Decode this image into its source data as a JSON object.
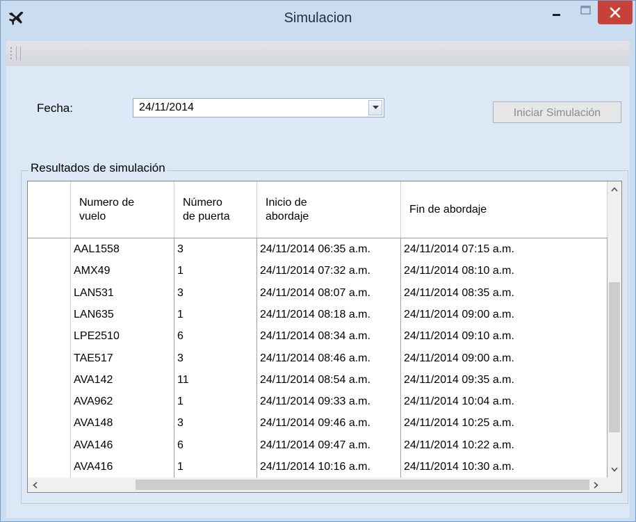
{
  "window": {
    "title": "Simulacion",
    "colors": {
      "frame": "#c9dcf0",
      "client": "#dce8f5",
      "close": "#c7413b"
    },
    "icon": "airplane-icon"
  },
  "form": {
    "fecha_label": "Fecha:",
    "fecha_value": "24/11/2014",
    "iniciar_label": "Iniciar Simulación"
  },
  "results": {
    "group_label": "Resultados de simulación",
    "columns": [
      {
        "line1": "Numero de",
        "line2": "vuelo"
      },
      {
        "line1": "Número",
        "line2": "de puerta"
      },
      {
        "line1": "Inicio de",
        "line2": "abordaje"
      },
      {
        "line1": "Fin de abordaje",
        "line2": ""
      }
    ],
    "rows": [
      [
        "AAL1558",
        "3",
        "24/11/2014 06:35 a.m.",
        "24/11/2014 07:15 a.m."
      ],
      [
        "AMX49",
        "1",
        "24/11/2014 07:32 a.m.",
        "24/11/2014 08:10 a.m."
      ],
      [
        "LAN531",
        "3",
        "24/11/2014 08:07 a.m.",
        "24/11/2014 08:35 a.m."
      ],
      [
        "LAN635",
        "1",
        "24/11/2014 08:18 a.m.",
        "24/11/2014 09:00 a.m."
      ],
      [
        "LPE2510",
        "6",
        "24/11/2014 08:34 a.m.",
        "24/11/2014 09:10 a.m."
      ],
      [
        "TAE517",
        "3",
        "24/11/2014 08:46 a.m.",
        "24/11/2014 09:00 a.m."
      ],
      [
        "AVA142",
        "11",
        "24/11/2014 08:54 a.m.",
        "24/11/2014 09:35 a.m."
      ],
      [
        "AVA962",
        "1",
        "24/11/2014 09:33 a.m.",
        "24/11/2014 10:04 a.m."
      ],
      [
        "AVA148",
        "3",
        "24/11/2014 09:46 a.m.",
        "24/11/2014 10:25 a.m."
      ],
      [
        "AVA146",
        "6",
        "24/11/2014 09:47 a.m.",
        "24/11/2014 10:22 a.m."
      ],
      [
        "AVA416",
        "1",
        "24/11/2014 10:16 a.m.",
        "24/11/2014 10:30 a.m."
      ]
    ]
  }
}
